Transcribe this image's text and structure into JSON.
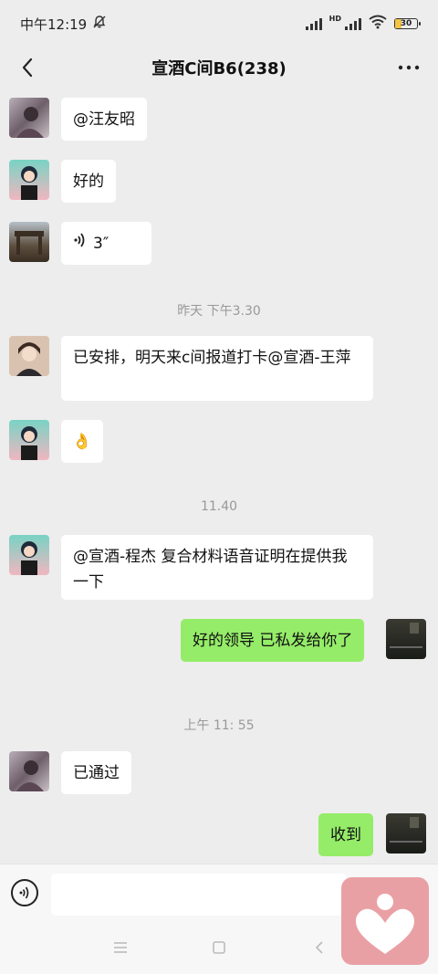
{
  "status": {
    "time": "中午12:19",
    "battery": "30",
    "hd": "HD"
  },
  "header": {
    "title": "宣酒C间B6(238)"
  },
  "messages": {
    "m1": "@汪友昭",
    "m2": "好的",
    "m3_voice": "3″",
    "ts1": "昨天 下午3.30",
    "m4": "已安排，明天来c间报道打卡@宣酒-王萍",
    "m5_emoji": "👌",
    "ts2": "11.40",
    "m6": "@宣酒-程杰 复合材料语音证明在提供我一下",
    "m7": "好的领导 已私发给你了",
    "ts3": "上午 11: 55",
    "m8": "已通过",
    "m9": "收到"
  },
  "composer": {
    "placeholder": ""
  },
  "icons": {
    "back": "back-arrow-icon",
    "more": "more-icon",
    "voice": "voice-icon",
    "silent": "bell-off-icon",
    "wifi": "wifi-icon",
    "signal": "signal-icon",
    "menu": "menu-icon",
    "home": "home-icon",
    "back_nav": "back-nav-icon",
    "overlay": "heart-app-icon"
  },
  "colors": {
    "background": "#ededed",
    "bubble_other": "#ffffff",
    "bubble_mine": "#95ec69",
    "overlay": "#e9a0a4"
  }
}
